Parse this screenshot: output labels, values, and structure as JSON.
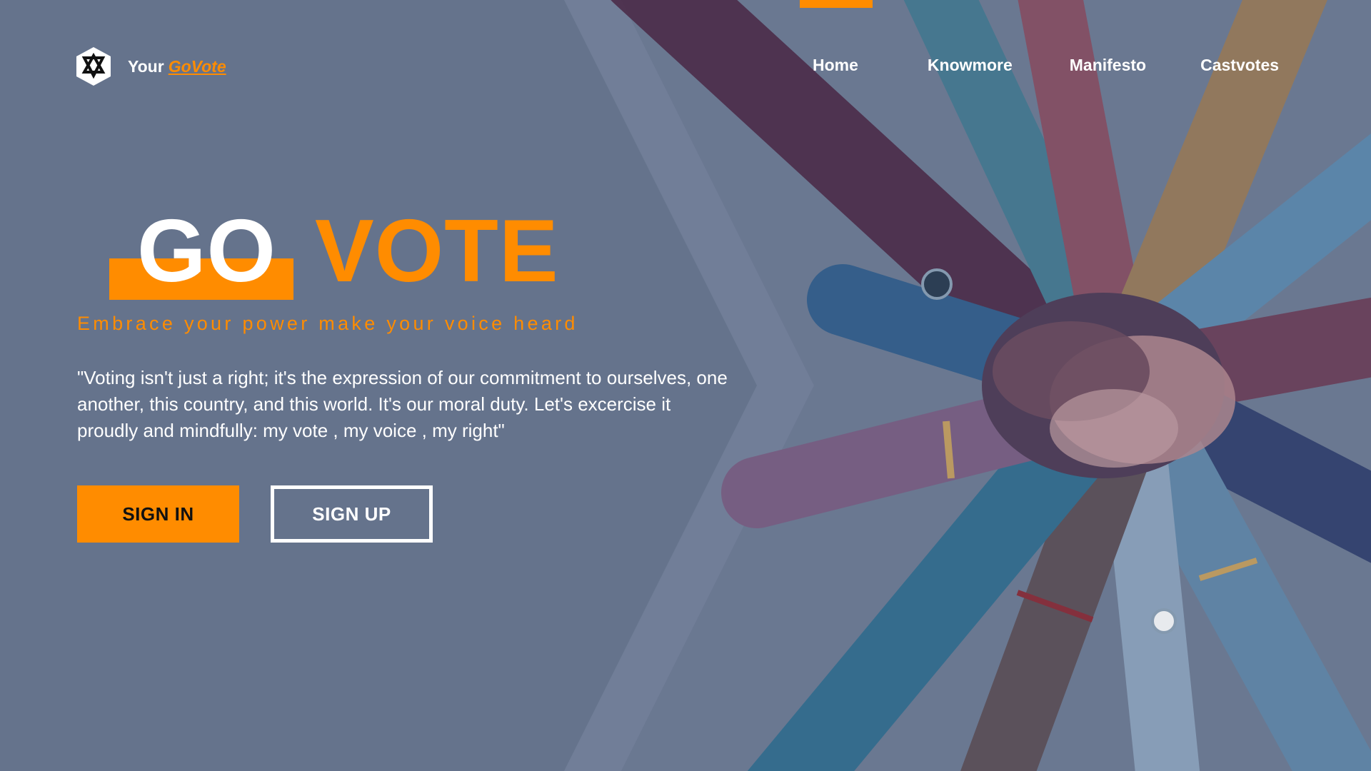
{
  "theme": {
    "accent": "#ff8c00",
    "background": "#66748c",
    "text": "#ffffff"
  },
  "logo": {
    "icon": "hexagon-vote-logo-icon",
    "prefix": "Your",
    "brand": "GoVote"
  },
  "nav": {
    "items": [
      {
        "label": "Home",
        "active": true
      },
      {
        "label": "Knowmore"
      },
      {
        "label": "Manifesto"
      },
      {
        "label": "Castvotes"
      }
    ]
  },
  "hero": {
    "title_white": "GO",
    "title_accent": "VOTE",
    "tagline": "Embrace your power make your voice heard",
    "quote": "\"Voting isn't just a right; it's the expression of our commitment to ourselves, one another, this country, and this world. It's our moral duty. Let's excercise it proudly and mindfully: my vote , my voice , my right\"",
    "illustration": "hands-stacked-together-illustration"
  },
  "buttons": {
    "signin_label": "SIGN IN",
    "signup_label": "SIGN UP"
  }
}
